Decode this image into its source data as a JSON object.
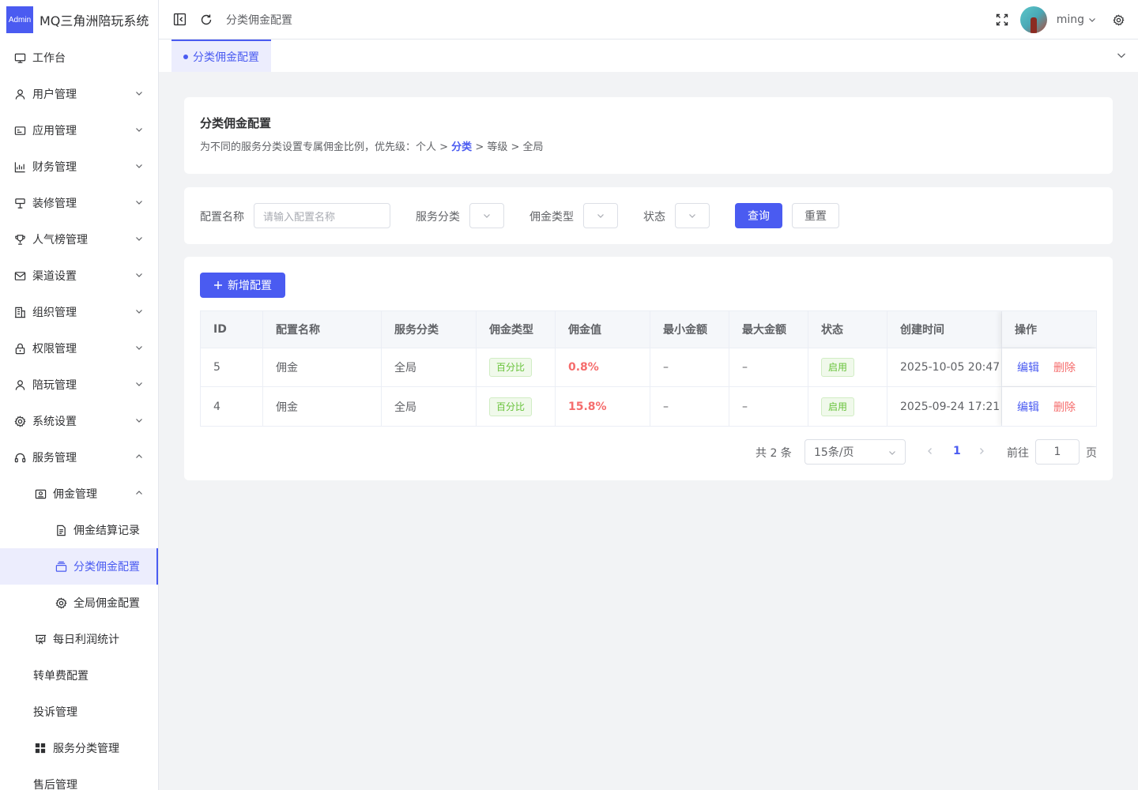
{
  "app": {
    "logo_text": "Admin",
    "title": "MQ三角洲陪玩系统"
  },
  "sidebar": {
    "items": [
      {
        "label": "工作台",
        "icon": "monitor-icon"
      },
      {
        "label": "用户管理",
        "icon": "user-icon"
      },
      {
        "label": "应用管理",
        "icon": "app-icon"
      },
      {
        "label": "财务管理",
        "icon": "chart-icon"
      },
      {
        "label": "装修管理",
        "icon": "decoration-icon"
      },
      {
        "label": "人气榜管理",
        "icon": "trophy-icon"
      },
      {
        "label": "渠道设置",
        "icon": "mail-icon"
      },
      {
        "label": "组织管理",
        "icon": "office-icon"
      },
      {
        "label": "权限管理",
        "icon": "lock-icon"
      },
      {
        "label": "陪玩管理",
        "icon": "user-icon"
      },
      {
        "label": "系统设置",
        "icon": "gear-icon"
      },
      {
        "label": "服务管理",
        "icon": "headset-icon"
      },
      {
        "label": "佣金管理",
        "icon": "wallet-icon"
      },
      {
        "label": "佣金结算记录",
        "icon": "document-icon"
      },
      {
        "label": "分类佣金配置",
        "icon": "stack-icon"
      },
      {
        "label": "全局佣金配置",
        "icon": "gear-icon"
      },
      {
        "label": "每日利润统计",
        "icon": "presentation-icon"
      },
      {
        "label": "转单费配置"
      },
      {
        "label": "投诉管理"
      },
      {
        "label": "服务分类管理",
        "icon": "grid-icon"
      },
      {
        "label": "售后管理"
      }
    ]
  },
  "header": {
    "breadcrumb": "分类佣金配置",
    "username": "ming"
  },
  "tabs": [
    {
      "label": "分类佣金配置"
    }
  ],
  "intro": {
    "title": "分类佣金配置",
    "desc_prefix": "为不同的服务分类设置专属佣金比例，优先级：个人 > ",
    "desc_highlight": "分类",
    "desc_suffix": " > 等级 > 全局"
  },
  "filters": {
    "name_label": "配置名称",
    "name_placeholder": "请输入配置名称",
    "category_label": "服务分类",
    "type_label": "佣金类型",
    "status_label": "状态",
    "search_button": "查询",
    "reset_button": "重置"
  },
  "toolbar": {
    "add_button": "新增配置"
  },
  "table": {
    "columns": [
      "ID",
      "配置名称",
      "服务分类",
      "佣金类型",
      "佣金值",
      "最小金额",
      "最大金额",
      "状态",
      "创建时间",
      "操作"
    ],
    "rows": [
      {
        "id": "5",
        "name": "佣金",
        "category": "全局",
        "type": "百分比",
        "value": "0.8%",
        "min": "–",
        "max": "–",
        "status": "启用",
        "created": "2025-10-05 20:47",
        "edit": "编辑",
        "delete": "删除"
      },
      {
        "id": "4",
        "name": "佣金",
        "category": "全局",
        "type": "百分比",
        "value": "15.8%",
        "min": "–",
        "max": "–",
        "status": "启用",
        "created": "2025-09-24 17:21",
        "edit": "编辑",
        "delete": "删除"
      }
    ]
  },
  "pagination": {
    "total": "共 2 条",
    "page_size": "15条/页",
    "current_page": "1",
    "goto_label": "前往",
    "goto_value": "1",
    "goto_suffix": "页"
  },
  "colors": {
    "primary": "#4a5bf1",
    "danger": "#f56c6c",
    "success": "#67c23a"
  }
}
